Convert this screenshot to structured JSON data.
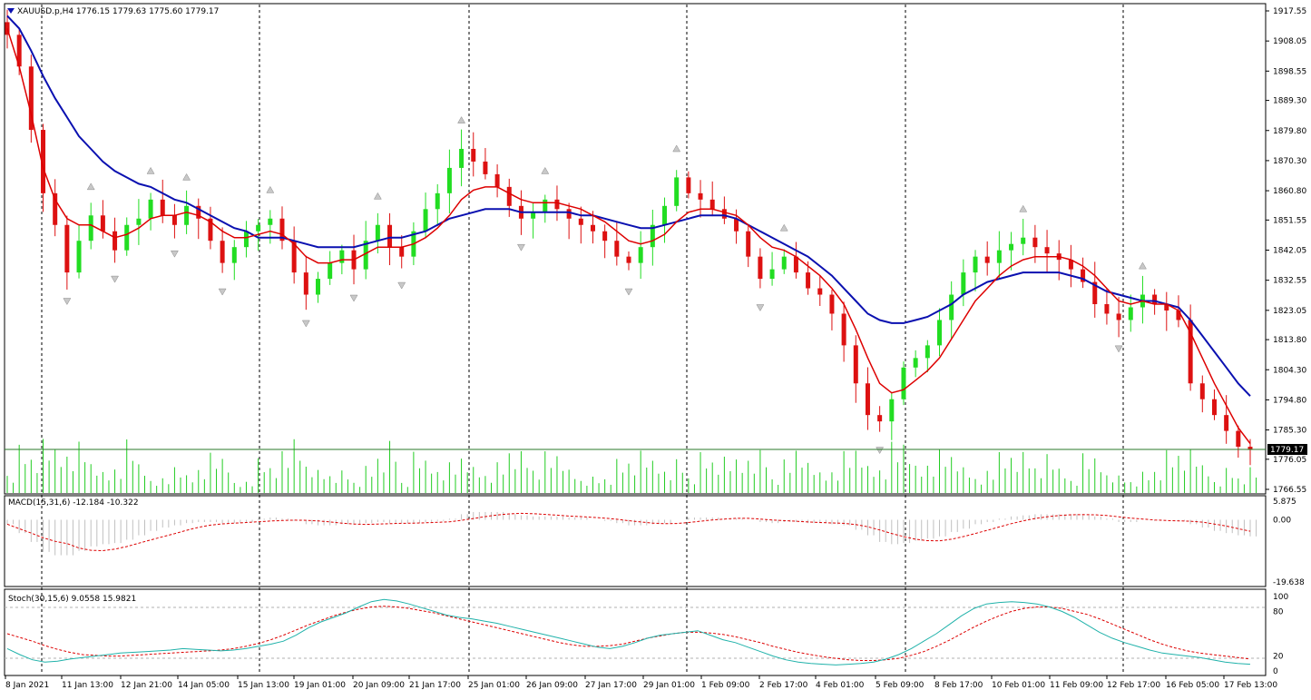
{
  "symbol_header": "XAUUSD.p,H4  1776.15 1779.63 1775.60 1779.17",
  "macd_header": "MACD(15,31,6) -12.184 -10.322",
  "stoch_header": "Stoch(30,15,6) 9.0558 15.9821",
  "current_price": "1779.17",
  "colors": {
    "bull": "#22dd22",
    "bear": "#dd1111",
    "ma_fast": "#dd0000",
    "ma_slow": "#0a10b0",
    "volume": "#22cc22",
    "macd_hist": "#c0c0c0",
    "macd_signal": "#dd0000",
    "stoch_main": "#20b2aa",
    "stoch_signal": "#dd0000",
    "price_label_bg": "#000000"
  },
  "chart_data": [
    {
      "type": "candlestick",
      "title": "XAUUSD.p,H4",
      "price_axis": [
        "1917.55",
        "1908.05",
        "1898.55",
        "1889.30",
        "1879.80",
        "1870.30",
        "1860.80",
        "1851.55",
        "1842.05",
        "1832.55",
        "1823.05",
        "1813.80",
        "1804.30",
        "1794.80",
        "1785.30",
        "1776.05",
        "1766.55"
      ],
      "ylim": [
        1766.55,
        1917.55
      ],
      "close_path": [
        1910,
        1900,
        1880,
        1860,
        1850,
        1835,
        1845,
        1853,
        1848,
        1842,
        1850,
        1852,
        1858,
        1853,
        1850,
        1856,
        1852,
        1845,
        1838,
        1843,
        1848,
        1850,
        1852,
        1845,
        1835,
        1828,
        1833,
        1838,
        1842,
        1836,
        1845,
        1850,
        1843,
        1840,
        1848,
        1855,
        1860,
        1868,
        1874,
        1870,
        1866,
        1862,
        1856,
        1852,
        1854,
        1858,
        1855,
        1852,
        1850,
        1848,
        1845,
        1840,
        1838,
        1843,
        1850,
        1856,
        1865,
        1860,
        1858,
        1855,
        1852,
        1848,
        1840,
        1833,
        1836,
        1840,
        1835,
        1830,
        1828,
        1822,
        1812,
        1800,
        1790,
        1788,
        1795,
        1805,
        1808,
        1812,
        1820,
        1828,
        1835,
        1840,
        1838,
        1842,
        1844,
        1846,
        1843,
        1841,
        1839,
        1836,
        1832,
        1825,
        1822,
        1820,
        1824,
        1828,
        1825,
        1823,
        1820,
        1800,
        1795,
        1790,
        1785,
        1780,
        1779
      ],
      "ma_fast": [
        1912,
        1900,
        1885,
        1868,
        1858,
        1852,
        1850,
        1850,
        1848,
        1846,
        1847,
        1849,
        1852,
        1853,
        1853,
        1854,
        1853,
        1851,
        1848,
        1846,
        1846,
        1847,
        1848,
        1847,
        1844,
        1840,
        1838,
        1838,
        1839,
        1839,
        1841,
        1843,
        1843,
        1843,
        1844,
        1846,
        1849,
        1853,
        1858,
        1861,
        1862,
        1862,
        1860,
        1858,
        1857,
        1857,
        1857,
        1856,
        1855,
        1853,
        1851,
        1848,
        1845,
        1844,
        1845,
        1847,
        1851,
        1854,
        1855,
        1855,
        1854,
        1853,
        1850,
        1846,
        1843,
        1842,
        1840,
        1837,
        1834,
        1830,
        1825,
        1817,
        1808,
        1800,
        1797,
        1798,
        1801,
        1804,
        1808,
        1814,
        1820,
        1826,
        1830,
        1834,
        1837,
        1839,
        1840,
        1840,
        1840,
        1839,
        1837,
        1834,
        1830,
        1826,
        1825,
        1826,
        1825,
        1825,
        1823,
        1816,
        1808,
        1800,
        1793,
        1786,
        1781
      ],
      "ma_slow": [
        1916,
        1912,
        1905,
        1897,
        1890,
        1884,
        1878,
        1874,
        1870,
        1867,
        1865,
        1863,
        1862,
        1860,
        1858,
        1857,
        1855,
        1853,
        1851,
        1849,
        1848,
        1846,
        1846,
        1846,
        1845,
        1844,
        1843,
        1843,
        1843,
        1843,
        1844,
        1845,
        1846,
        1846,
        1847,
        1848,
        1850,
        1852,
        1853,
        1854,
        1855,
        1855,
        1855,
        1854,
        1854,
        1854,
        1854,
        1854,
        1853,
        1853,
        1852,
        1851,
        1850,
        1849,
        1849,
        1850,
        1851,
        1852,
        1853,
        1853,
        1853,
        1852,
        1850,
        1848,
        1846,
        1844,
        1842,
        1840,
        1837,
        1834,
        1830,
        1826,
        1822,
        1820,
        1819,
        1819,
        1820,
        1821,
        1823,
        1825,
        1828,
        1830,
        1832,
        1833,
        1834,
        1835,
        1835,
        1835,
        1835,
        1834,
        1833,
        1831,
        1829,
        1828,
        1827,
        1826,
        1826,
        1825,
        1824,
        1820,
        1815,
        1810,
        1805,
        1800,
        1796
      ]
    },
    {
      "type": "histogram",
      "title": "MACD(15,31,6)",
      "axis_labels": [
        "5.875",
        "0.00",
        "-19.638"
      ],
      "ylim": [
        -19.638,
        5.875
      ]
    },
    {
      "type": "line",
      "title": "Stoch(30,15,6)",
      "axis_labels": [
        "100",
        "80",
        "20",
        "0"
      ],
      "ylim": [
        0,
        100
      ],
      "main": [
        30,
        22,
        15,
        12,
        13,
        16,
        18,
        20,
        22,
        24,
        25,
        26,
        27,
        28,
        30,
        29,
        28,
        27,
        28,
        30,
        33,
        36,
        40,
        48,
        58,
        66,
        72,
        78,
        86,
        93,
        96,
        94,
        90,
        85,
        80,
        75,
        72,
        70,
        67,
        64,
        60,
        56,
        52,
        48,
        44,
        40,
        36,
        32,
        30,
        33,
        38,
        44,
        48,
        50,
        52,
        54,
        48,
        42,
        38,
        32,
        26,
        20,
        15,
        12,
        10,
        9,
        8,
        9,
        10,
        12,
        16,
        22,
        30,
        40,
        50,
        62,
        74,
        84,
        90,
        92,
        93,
        92,
        90,
        86,
        80,
        72,
        62,
        52,
        44,
        38,
        33,
        28,
        24,
        22,
        20,
        18,
        15,
        12,
        10,
        9
      ],
      "signal": [
        50,
        45,
        40,
        34,
        29,
        25,
        22,
        21,
        20,
        20,
        21,
        22,
        23,
        24,
        25,
        26,
        27,
        28,
        30,
        33,
        37,
        42,
        48,
        55,
        62,
        68,
        74,
        79,
        83,
        86,
        87,
        86,
        84,
        81,
        78,
        74,
        70,
        66,
        62,
        58,
        54,
        50,
        46,
        42,
        38,
        35,
        33,
        33,
        34,
        36,
        40,
        44,
        47,
        50,
        52,
        52,
        51,
        49,
        46,
        42,
        38,
        33,
        29,
        25,
        22,
        19,
        17,
        15,
        14,
        14,
        15,
        17,
        21,
        26,
        33,
        41,
        50,
        59,
        67,
        74,
        80,
        84,
        86,
        86,
        84,
        80,
        76,
        70,
        63,
        56,
        49,
        42,
        36,
        31,
        27,
        24,
        22,
        20,
        18,
        16
      ]
    }
  ],
  "time_axis": [
    "8 Jan 2021",
    "11 Jan 13:00",
    "12 Jan 21:00",
    "14 Jan 05:00",
    "15 Jan 13:00",
    "19 Jan 01:00",
    "20 Jan 09:00",
    "21 Jan 17:00",
    "25 Jan 01:00",
    "26 Jan 09:00",
    "27 Jan 17:00",
    "29 Jan 01:00",
    "1 Feb 09:00",
    "2 Feb 17:00",
    "4 Feb 01:00",
    "5 Feb 09:00",
    "8 Feb 17:00",
    "10 Feb 01:00",
    "11 Feb 09:00",
    "12 Feb 17:00",
    "16 Feb 05:00",
    "17 Feb 13:00"
  ]
}
